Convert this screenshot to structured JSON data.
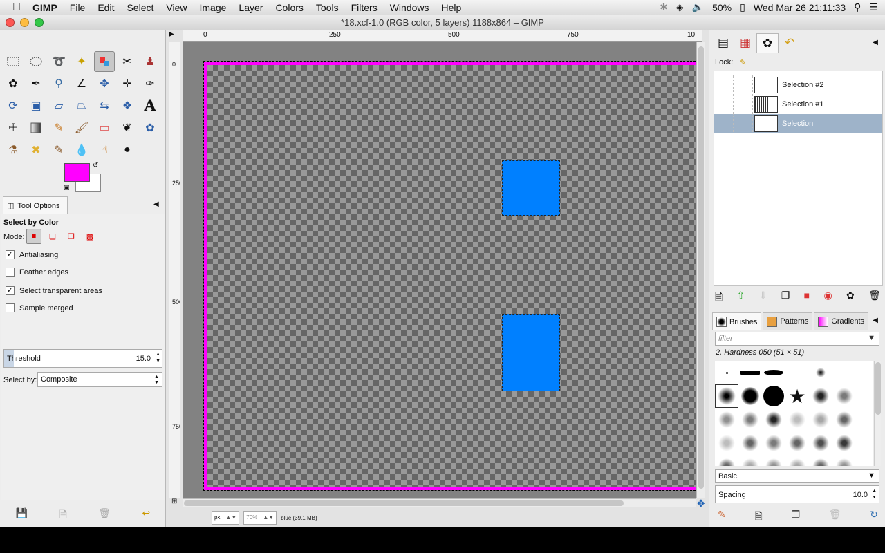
{
  "menubar": {
    "app": "GIMP",
    "items": [
      "File",
      "Edit",
      "Select",
      "View",
      "Image",
      "Layer",
      "Colors",
      "Tools",
      "Filters",
      "Windows",
      "Help"
    ],
    "battery": "50%",
    "clock": "Wed Mar 26  21:11:33"
  },
  "window": {
    "title": "*18.xcf-1.0 (RGB color, 5 layers) 1188x864 – GIMP"
  },
  "colors": {
    "foreground": "#ff00ff",
    "background": "#ffffff",
    "selection_fill": "#0080ff",
    "layer_selected": "#9eb3c9"
  },
  "toolbox": {
    "tools": [
      "rect-select",
      "ellipse-select",
      "free-select",
      "fuzzy-select",
      "select-by-color",
      "scissors",
      "foreground-select",
      "paths",
      "color-picker",
      "zoom",
      "measure",
      "move",
      "align",
      "crop",
      "rotate",
      "scale",
      "shear",
      "perspective",
      "flip",
      "cage",
      "text",
      "bucket-fill",
      "blend",
      "pencil",
      "paintbrush",
      "eraser",
      "airbrush",
      "ink",
      "clone",
      "heal",
      "perspective-clone",
      "blur",
      "smudge",
      "dodge-burn"
    ]
  },
  "tool_options": {
    "tab_label": "Tool Options",
    "heading": "Select by Color",
    "mode_label": "Mode:",
    "antialiasing": {
      "label": "Antialiasing",
      "checked": true
    },
    "feather": {
      "label": "Feather edges",
      "checked": false
    },
    "transparent": {
      "label": "Select transparent areas",
      "checked": true
    },
    "sample_merged": {
      "label": "Sample merged",
      "checked": false
    },
    "threshold": {
      "label": "Threshold",
      "value": "15.0"
    },
    "select_by": {
      "label": "Select by:",
      "value": "Composite"
    }
  },
  "canvas": {
    "hruler": [
      "0",
      "250",
      "500",
      "750",
      "10"
    ],
    "vruler": [
      "0",
      "250",
      "500",
      "750"
    ],
    "status": {
      "unit": "px",
      "zoom": "70%",
      "info": "blue (39.1 MB)"
    }
  },
  "layers": {
    "lock_label": "Lock:",
    "items": [
      {
        "name": "Selection #2",
        "selected": false
      },
      {
        "name": "Selection #1",
        "selected": false
      },
      {
        "name": "Selection",
        "selected": true
      }
    ]
  },
  "brushes": {
    "tabs": [
      "Brushes",
      "Patterns",
      "Gradients"
    ],
    "filter_placeholder": "filter",
    "selected_name": "2. Hardness 050 (51 × 51)",
    "preset": "Basic,",
    "spacing": {
      "label": "Spacing",
      "value": "10.0"
    }
  }
}
